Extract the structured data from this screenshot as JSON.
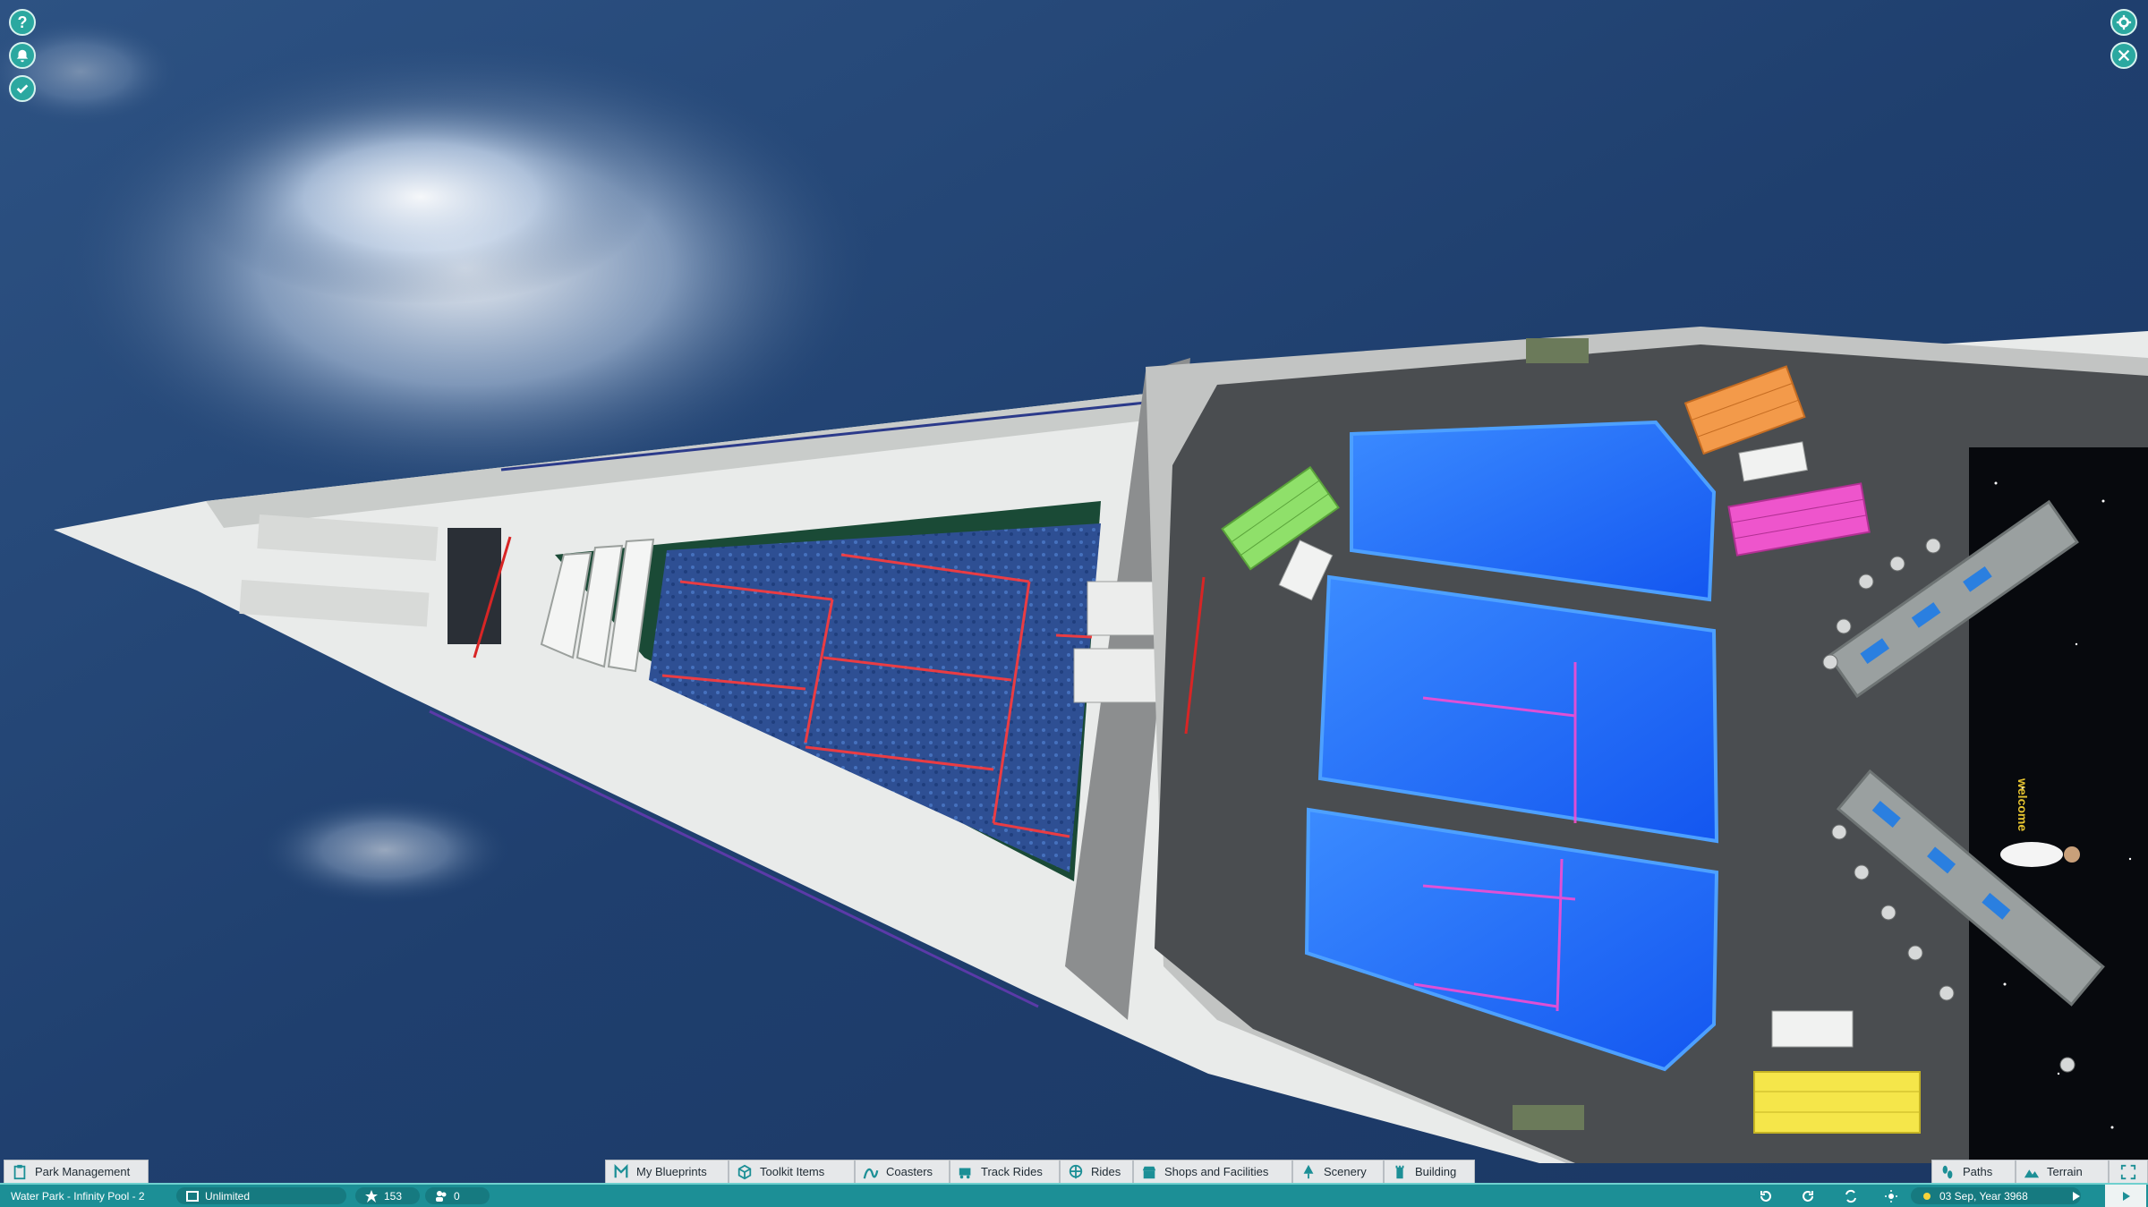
{
  "colors": {
    "ocean": "#1f3f6e",
    "accent_teal": "#1c8f96",
    "tab_bg": "#e6e8ea",
    "pool_blue": "#1f6fff",
    "bench_orange": "#f39a4a",
    "bench_pink": "#ee55cc",
    "bench_green": "#8fe06a",
    "bench_yellow": "#f5e64a"
  },
  "corner_buttons": {
    "left": [
      {
        "label": "?",
        "icon": "help-icon"
      },
      {
        "icon": "bell-icon"
      },
      {
        "icon": "check-icon"
      }
    ],
    "right": [
      {
        "icon": "gear-icon"
      },
      {
        "icon": "camera-icon"
      }
    ]
  },
  "toolbar": {
    "park_management": "Park Management",
    "my_blueprints": "My Blueprints",
    "toolkit_items": "Toolkit Items",
    "coasters": "Coasters",
    "track_rides": "Track Rides",
    "rides": "Rides",
    "shops_and_facilities": "Shops and Facilities",
    "scenery": "Scenery",
    "building": "Building",
    "paths": "Paths",
    "terrain": "Terrain"
  },
  "status": {
    "park_name": "Water Park - Infinity Pool - 2",
    "money": "Unlimited",
    "rating": "153",
    "guests": "0",
    "date": "03 Sep, Year 3968"
  },
  "scene_text": {
    "welcome_sign": "welcome"
  }
}
